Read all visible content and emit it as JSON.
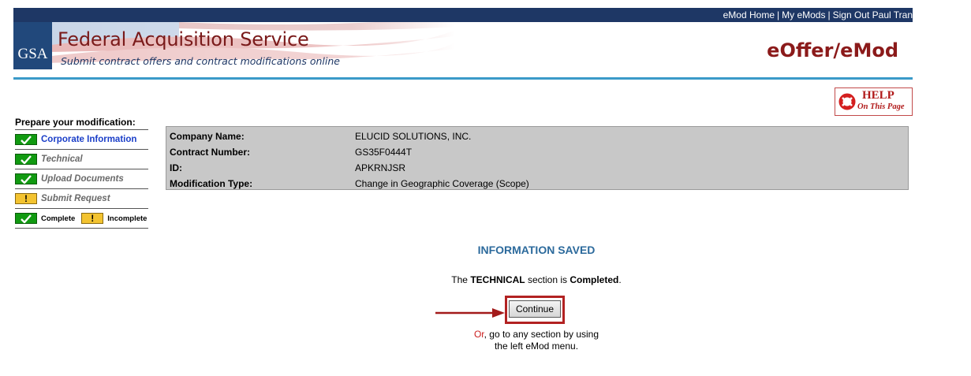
{
  "header": {
    "links": [
      {
        "label": "eMod Home"
      },
      {
        "label": "My eMods"
      },
      {
        "label": "Sign Out Paul Tran"
      }
    ],
    "logo_text": "GSA",
    "title": "Federal Acquisition Service",
    "subtitle": "Submit contract offers and contract modifications online",
    "app_name": "eOffer/eMod"
  },
  "help": {
    "title": "HELP",
    "subtitle": "On This Page"
  },
  "menu": {
    "heading": "Prepare your modification:",
    "items": [
      {
        "label": "Corporate Information",
        "status": "complete",
        "active": true
      },
      {
        "label": "Technical",
        "status": "complete",
        "active": false
      },
      {
        "label": "Upload Documents",
        "status": "complete",
        "active": false
      },
      {
        "label": "Submit Request",
        "status": "incomplete",
        "active": false
      }
    ],
    "legend": {
      "complete": "Complete",
      "incomplete": "Incomplete"
    }
  },
  "info": {
    "rows": [
      {
        "label": "Company Name:",
        "value": "ELUCID SOLUTIONS, INC."
      },
      {
        "label": "Contract Number:",
        "value": "GS35F0444T"
      },
      {
        "label": "ID:",
        "value": "APKRNJSR"
      },
      {
        "label": "Modification Type:",
        "value": "Change in Geographic Coverage (Scope)"
      }
    ]
  },
  "message": {
    "title": "INFORMATION SAVED",
    "prefix": "The ",
    "section": "TECHNICAL",
    "middle": " section is ",
    "status": "Completed",
    "suffix": ".",
    "button": "Continue",
    "or_label": "Or",
    "or_line1": ", go to any section by using",
    "or_line2": "the left eMod menu."
  },
  "colors": {
    "topbar": "#1e3765",
    "rule": "#3a9ac8",
    "brand_red": "#8b1a1a",
    "complete_green": "#119a11",
    "incomplete_yellow": "#f3c330",
    "highlight": "#b22222"
  }
}
